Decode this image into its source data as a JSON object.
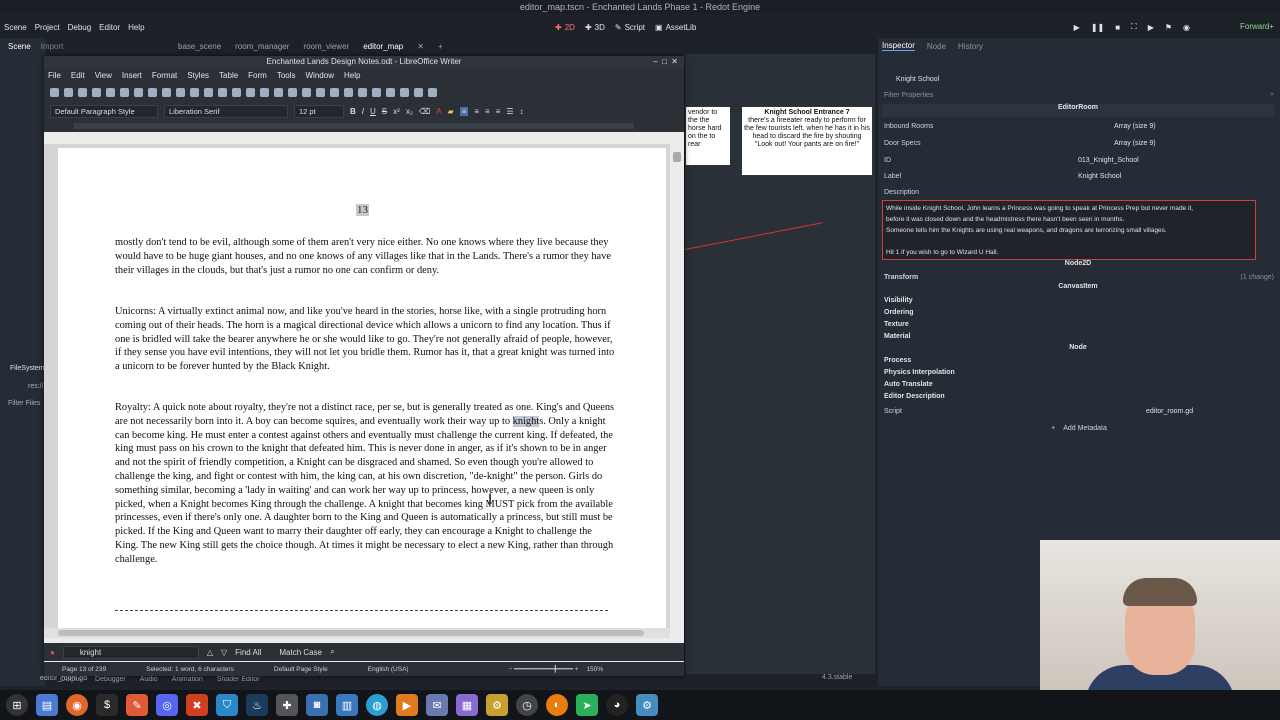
{
  "godot": {
    "window_title": "editor_map.tscn - Enchanted Lands Phase 1 - Redot Engine",
    "menu": [
      "Scene",
      "Project",
      "Debug",
      "Editor",
      "Help"
    ],
    "workspaces": [
      "2D",
      "3D",
      "Script",
      "AssetLib"
    ],
    "renderer": "Forward+",
    "scene_dock_tabs": [
      "Scene",
      "Import"
    ],
    "editor_tabs": [
      "base_scene",
      "room_manager",
      "room_viewer",
      "editor_map"
    ],
    "filesystem_label": "FileSystem",
    "res_label": "res://",
    "filter_files": "Filter Files",
    "bottom_tabs": [
      "Output",
      "Debugger",
      "Audio",
      "Animation",
      "Shader Editor"
    ],
    "version": "4.3.stable",
    "status_file": "editor_room.gd",
    "viewport_node_title": "Knight School Entrance 7",
    "viewport_node_text": "there's a fireeater ready to perform for the few tourists left. when he has it in his head to discard the fire by shouting \"Look out! Your pants are on fire!\"",
    "viewport_left_text": "vendor to the the horse hard on the to rear"
  },
  "inspector": {
    "tabs": [
      "Inspector",
      "Node",
      "History"
    ],
    "node_name": "Knight School",
    "filter_placeholder": "Filter Properties",
    "class_header": "EditorRoom",
    "inbound_rooms_label": "Inbound Rooms",
    "inbound_rooms_value": "Array (size 9)",
    "door_specs_label": "Door Specs",
    "door_specs_value": "Array (size 9)",
    "id_label": "ID",
    "id_value": "013_Knight_School",
    "label_label": "Label",
    "label_value": "Knight School",
    "description_label": "Description",
    "description_lines": [
      "While inside Knight School, John learns a Princess was going to speak at Princess Prep but never made it,",
      "before it was closed down and the headmistress there hasn't been seen in months.",
      "Someone tells him the Knights are using real weapons, and dragons are terrorizing small villages.",
      "",
      "Hit 1 if you wish to go to Wizard U Hall."
    ],
    "node2d_header": "Node2D",
    "transform_label": "Transform",
    "transform_change": "(1 change)",
    "canvasitem_header": "CanvasItem",
    "canvas_sections": [
      "Visibility",
      "Ordering",
      "Texture",
      "Material"
    ],
    "node_header": "Node",
    "node_sections": [
      "Process",
      "Physics Interpolation",
      "Auto Translate",
      "Editor Description"
    ],
    "script_label": "Script",
    "script_value": "editor_room.gd",
    "add_metadata": "Add Metadata"
  },
  "writer": {
    "window_title": "Enchanted Lands Design Notes.odt - LibreOffice Writer",
    "menu": [
      "File",
      "Edit",
      "View",
      "Insert",
      "Format",
      "Styles",
      "Table",
      "Form",
      "Tools",
      "Window",
      "Help"
    ],
    "paragraph_style": "Default Paragraph Style",
    "font_name": "Liberation Serif",
    "font_size": "12 pt",
    "page_number": "13",
    "paragraph1": "mostly don't tend to be evil, although some of them aren't very nice either.  No one knows where they live because they would have to be huge giant houses, and no one knows of any villages like that in the Lands.  There's a rumor they have their villages in the clouds, but that's just a rumor no one can confirm or deny.",
    "paragraph2": "Unicorns:  A virtually extinct animal now, and like you've heard in the stories, horse like, with a single protruding horn coming out of their heads.  The horn is a magical directional device which allows a unicorn to find any location.  Thus if one is bridled will take the bearer anywhere he or she would like to go.  They're not generally afraid of people, however, if they sense you have evil intentions, they will not let you bridle them.  Rumor has it, that a great knight was turned into a unicorn to be forever hunted by the Black Knight.",
    "paragraph3_before": "Royalty:  A quick note about royalty, they're not a distinct race, per se, but is generally treated as one.  King's and Queens are not necessarily born into it.  A boy can become squires, and eventually work their way up to ",
    "paragraph3_highlight": "knight",
    "paragraph3_after": "s.  Only a knight can become king.  He must enter a contest against others and eventually must challenge the current king.  If defeated, the king must pass on his crown to the knight that defeated him.  This is never done in anger, as if it's shown to be in anger and not the spirit of friendly competition, a Knight can be disgraced and shamed.  So even though you're allowed to challenge the king, and fight or contest with him, the king can, at his own discretion, \"de-knight\" the person.  Girls do something similar, becoming a 'lady in waiting' and can work her way up to princess, however, a new queen is only picked, when a Knight becomes King through the challenge.  A knight that becomes king MUST pick from the available princesses, even if there's only one.  A daughter born to the King and Queen is automatically a princess, but still must be picked.  If the King and Queen want to marry their daughter off early, they can encourage a Knight to challenge the King.  The new King still gets the choice though.  At times it might be necessary to elect a new King, rather than through challenge.",
    "find_value": "knight",
    "find_all": "Find All",
    "match_case": "Match Case",
    "status_page": "Page 13 of 239",
    "status_selection": "Selected: 1 word, 6 characters",
    "status_page_style": "Default Page Style",
    "status_language": "English (USA)",
    "status_zoom": "150%"
  }
}
